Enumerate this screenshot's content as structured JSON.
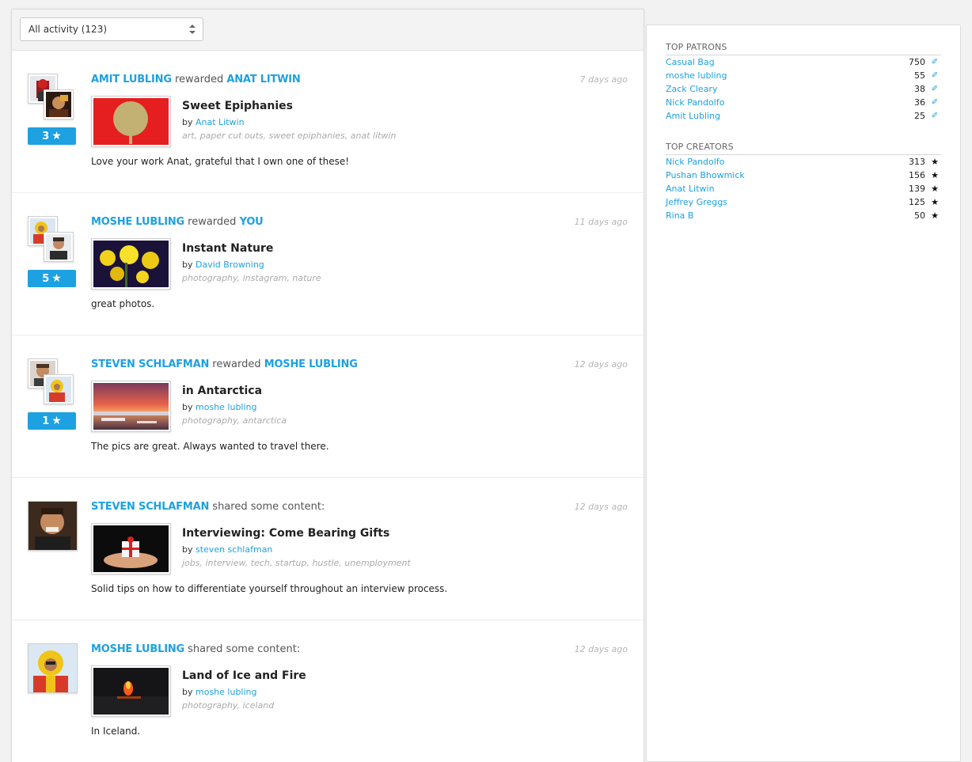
{
  "filter": {
    "label": "All activity (123)"
  },
  "feed": [
    {
      "actor": "AMIT LUBLING",
      "verb": "rewarded",
      "target": "ANAT LITWIN",
      "time": "7 days ago",
      "stars": "3",
      "title": "Sweet Epiphanies",
      "by_prefix": "by",
      "author": "Anat Litwin",
      "tags": [
        "art",
        "paper cut outs",
        "sweet epiphanies",
        "anat litwin"
      ],
      "comment": "Love your work Anat, grateful that I own one of these!"
    },
    {
      "actor": "MOSHE LUBLING",
      "verb": "rewarded",
      "target": "YOU",
      "time": "11 days ago",
      "stars": "5",
      "title": "Instant Nature",
      "by_prefix": "by",
      "author": "David Browning",
      "tags": [
        "photography",
        "instagram",
        "nature"
      ],
      "comment": "great photos."
    },
    {
      "actor": "STEVEN SCHLAFMAN",
      "verb": "rewarded",
      "target": "MOSHE LUBLING",
      "time": "12 days ago",
      "stars": "1",
      "title": "in Antarctica",
      "by_prefix": "by",
      "author": "moshe lubling",
      "tags": [
        "photography",
        "antarctica"
      ],
      "comment": "The pics are great. Always wanted to travel there."
    },
    {
      "actor": "STEVEN SCHLAFMAN",
      "verb": "shared some content:",
      "target": "",
      "time": "12 days ago",
      "stars": "",
      "title": "Interviewing: Come Bearing Gifts",
      "by_prefix": "by",
      "author": "steven schlafman",
      "tags": [
        "jobs",
        "interview",
        "tech",
        "startup",
        "hustle",
        "unemployment"
      ],
      "comment": "Solid tips on how to differentiate yourself throughout an interview process."
    },
    {
      "actor": "MOSHE LUBLING",
      "verb": "shared some content:",
      "target": "",
      "time": "12 days ago",
      "stars": "",
      "title": "Land of Ice and Fire",
      "by_prefix": "by",
      "author": "moshe lubling",
      "tags": [
        "photography",
        "iceland"
      ],
      "comment": "In Iceland."
    }
  ],
  "sidebar": {
    "top_patrons": {
      "heading": "TOP PATRONS",
      "rows": [
        {
          "name": "Casual Bag",
          "value": "750"
        },
        {
          "name": "moshe lubling",
          "value": "55"
        },
        {
          "name": "Zack Cleary",
          "value": "38"
        },
        {
          "name": "Nick Pandolfo",
          "value": "36"
        },
        {
          "name": "Amit Lubling",
          "value": "25"
        }
      ]
    },
    "top_creators": {
      "heading": "TOP CREATORS",
      "rows": [
        {
          "name": "Nick Pandolfo",
          "value": "313"
        },
        {
          "name": "Pushan Bhowmick",
          "value": "156"
        },
        {
          "name": "Anat Litwin",
          "value": "139"
        },
        {
          "name": "Jeffrey Greggs",
          "value": "125"
        },
        {
          "name": "Rina B",
          "value": "50"
        }
      ]
    }
  },
  "colors": {
    "accent": "#1da1e0",
    "badge": "#1da1e0"
  },
  "icons": {
    "reward": "star-icon",
    "patron": "patron-icon",
    "creator": "star-icon",
    "select": "select-arrows-icon"
  }
}
